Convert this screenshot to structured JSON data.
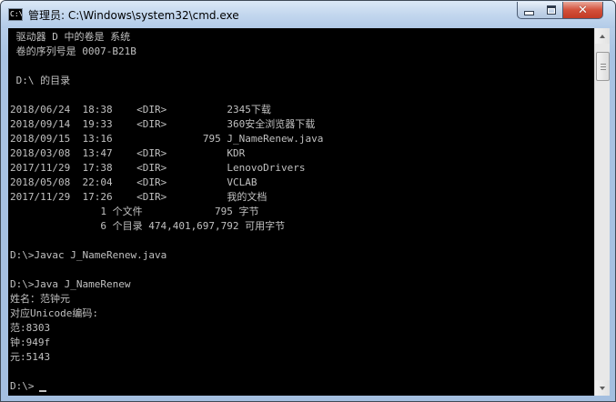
{
  "window": {
    "icon_text": "C:\\",
    "title": "管理员: C:\\Windows\\system32\\cmd.exe",
    "minimize_label": "",
    "maximize_label": "",
    "close_label": "✕"
  },
  "console": {
    "lines": [
      " 驱动器 D 中的卷是 系统",
      " 卷的序列号是 0007-B21B",
      "",
      " D:\\ 的目录",
      "",
      "2018/06/24  18:38    <DIR>          2345下载",
      "2018/09/14  19:33    <DIR>          360安全浏览器下载",
      "2018/09/15  13:16               795 J_NameRenew.java",
      "2018/03/08  13:47    <DIR>          KDR",
      "2017/11/29  17:38    <DIR>          LenovoDrivers",
      "2018/05/08  22:04    <DIR>          VCLAB",
      "2017/11/29  17:26    <DIR>          我的文档",
      "               1 个文件            795 字节",
      "               6 个目录 474,401,697,792 可用字节",
      "",
      "D:\\>Javac J_NameRenew.java",
      "",
      "D:\\>Java J_NameRenew",
      "姓名：范钟元",
      "对应Unicode编码:",
      "范:8303",
      "钟:949f",
      "元:5143",
      "",
      "D:\\>"
    ]
  },
  "colors": {
    "console_bg": "#000000",
    "console_fg": "#c0c0c0",
    "close_red": "#c23a24"
  },
  "icons": {
    "app": "cmd-icon",
    "minimize": "minimize-icon",
    "maximize": "maximize-icon",
    "close": "close-icon"
  }
}
